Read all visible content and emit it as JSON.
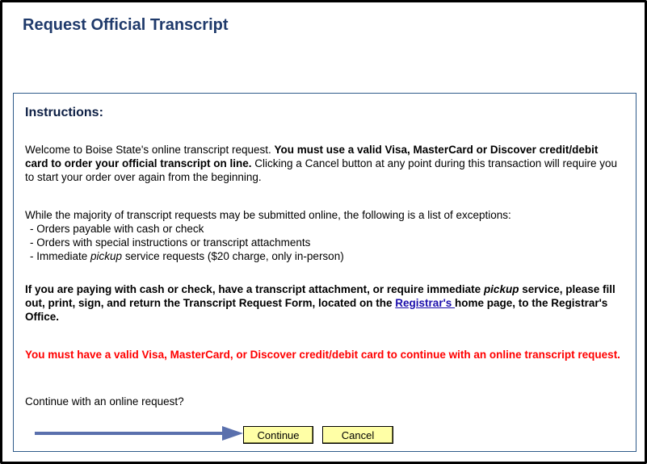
{
  "header": {
    "title": "Request Official Transcript"
  },
  "instructions": {
    "heading": "Instructions:",
    "welcome_plain": "Welcome to Boise State's online transcript request. ",
    "welcome_bold": "You must use a valid Visa, MasterCard or Discover credit/debit card to order your official transcript on line.",
    "welcome_tail": " Clicking a Cancel button at any point during this transaction will require you to start your order over again from the beginning.",
    "exceptions_intro": "While the majority of transcript requests may be submitted online, the following is a list of exceptions:",
    "exceptions": [
      {
        "text": "- Orders payable with cash or check"
      },
      {
        "text": "- Orders with special instructions or transcript attachments"
      },
      {
        "pre": "- Immediate ",
        "em": "pickup",
        "post": " service requests ($20 charge, only in-person)"
      }
    ],
    "paper_form_pre": "If you are paying with cash or check, have a transcript attachment, or require immediate ",
    "paper_form_em": "pickup",
    "paper_form_mid": " service, please fill out, print, sign, and return the Transcript Request Form, located on the ",
    "registrar_link": "Registrar's ",
    "paper_form_post": "home page, to the Registrar's Office.",
    "card_warning": "You must have a valid Visa, MasterCard, or Discover credit/debit card to continue with an online transcript request.",
    "prompt": "Continue with an online request?"
  },
  "buttons": {
    "continue_label": "Continue",
    "cancel_label": "Cancel"
  },
  "colors": {
    "title": "#1f3a6b",
    "warning": "#ff0000",
    "button_bg": "#ffffa6",
    "arrow": "#5a70ad",
    "panel_border": "#2f5b8a"
  },
  "icons": {
    "pointer": "arrow-right-icon"
  }
}
